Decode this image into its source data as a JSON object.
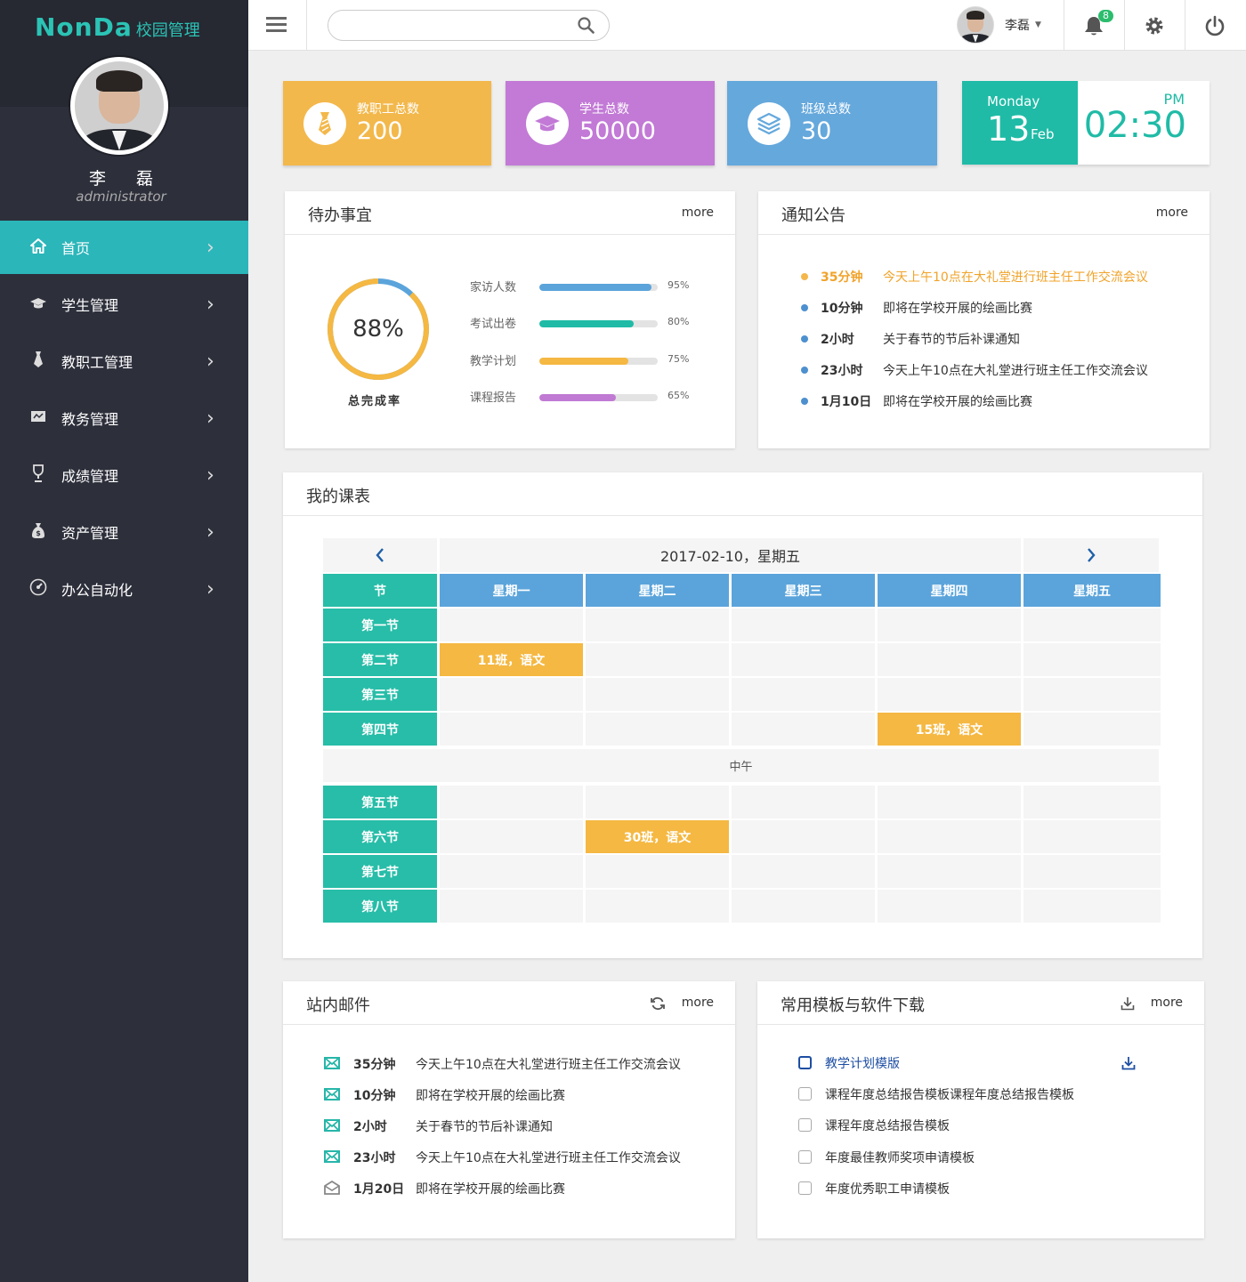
{
  "app": {
    "logo": "NonDa",
    "logo_sub": "校园管理"
  },
  "user": {
    "name": "李磊",
    "display_name": "李 磊",
    "role": "administrator"
  },
  "sidebar": {
    "items": [
      {
        "label": "首页",
        "icon": "home-icon",
        "active": true
      },
      {
        "label": "学生管理",
        "icon": "graduation-cap-icon"
      },
      {
        "label": "教职工管理",
        "icon": "tie-icon"
      },
      {
        "label": "教务管理",
        "icon": "board-icon"
      },
      {
        "label": "成绩管理",
        "icon": "trophy-icon"
      },
      {
        "label": "资产管理",
        "icon": "money-bag-icon"
      },
      {
        "label": "办公自动化",
        "icon": "gauge-icon"
      }
    ]
  },
  "topbar": {
    "search_placeholder": "",
    "search_value": "",
    "notification_count": "8"
  },
  "stats": [
    {
      "label": "教职工总数",
      "value": "200",
      "color": "#f3b84b",
      "icon": "tie-icon"
    },
    {
      "label": "学生总数",
      "value": "50000",
      "color": "#c27ad6",
      "icon": "graduation-cap-icon"
    },
    {
      "label": "班级总数",
      "value": "30",
      "color": "#65a8dc",
      "icon": "layers-icon"
    }
  ],
  "date": {
    "weekday": "Monday",
    "day": "13",
    "month": "Feb",
    "ampm": "PM",
    "time": "02:30"
  },
  "todo": {
    "title": "待办事宜",
    "more": "more",
    "rate": 88,
    "rate_label": "88%",
    "rate_caption": "总完成率",
    "items": [
      {
        "label": "家访人数",
        "percent": 95,
        "percent_label": "95%",
        "color": "#5ba4db"
      },
      {
        "label": "考试出卷",
        "percent": 80,
        "percent_label": "80%",
        "color": "#1fbba6"
      },
      {
        "label": "教学计划",
        "percent": 75,
        "percent_label": "75%",
        "color": "#f5b842"
      },
      {
        "label": "课程报告",
        "percent": 65,
        "percent_label": "65%",
        "color": "#c07ad3"
      }
    ]
  },
  "notice": {
    "title": "通知公告",
    "more": "more",
    "items": [
      {
        "time": "35分钟",
        "text": "今天上午10点在大礼堂进行班主任工作交流会议",
        "highlight": true
      },
      {
        "time": "10分钟",
        "text": "即将在学校开展的绘画比赛"
      },
      {
        "time": "2小时",
        "text": "关于春节的节后补课通知"
      },
      {
        "time": "23小时",
        "text": "今天上午10点在大礼堂进行班主任工作交流会议"
      },
      {
        "time": "1月10日",
        "text": "即将在学校开展的绘画比赛"
      }
    ]
  },
  "schedule": {
    "title": "我的课表",
    "current_date": "2017-02-10，星期五",
    "corner": "节",
    "days": [
      "星期一",
      "星期二",
      "星期三",
      "星期四",
      "星期五"
    ],
    "periods": [
      "第一节",
      "第二节",
      "第三节",
      "第四节",
      "第五节",
      "第六节",
      "第七节",
      "第八节"
    ],
    "noon": "中午",
    "events": [
      {
        "period": 1,
        "day": 0,
        "text": "11班，语文"
      },
      {
        "period": 3,
        "day": 3,
        "text": "15班，语文"
      },
      {
        "period": 5,
        "day": 1,
        "text": "30班，语文"
      }
    ]
  },
  "mail": {
    "title": "站内邮件",
    "more": "more",
    "items": [
      {
        "time": "35分钟",
        "text": "今天上午10点在大礼堂进行班主任工作交流会议",
        "unread": true
      },
      {
        "time": "10分钟",
        "text": "即将在学校开展的绘画比赛",
        "unread": true
      },
      {
        "time": "2小时",
        "text": "关于春节的节后补课通知",
        "unread": true
      },
      {
        "time": "23小时",
        "text": "今天上午10点在大礼堂进行班主任工作交流会议",
        "unread": true
      },
      {
        "time": "1月20日",
        "text": "即将在学校开展的绘画比赛",
        "unread": false
      }
    ]
  },
  "downloads": {
    "title": "常用模板与软件下载",
    "more": "more",
    "items": [
      {
        "label": "教学计划模版",
        "selected": true
      },
      {
        "label": "课程年度总结报告模板课程年度总结报告模板"
      },
      {
        "label": "课程年度总结报告模板"
      },
      {
        "label": "年度最佳教师奖项申请模板"
      },
      {
        "label": "年度优秀职工申请模板"
      }
    ]
  },
  "colors": {
    "teal": "#2bb6ba",
    "sidebar": "#2d2f3b",
    "accent_orange": "#f5b842",
    "blue": "#5ba4db"
  }
}
